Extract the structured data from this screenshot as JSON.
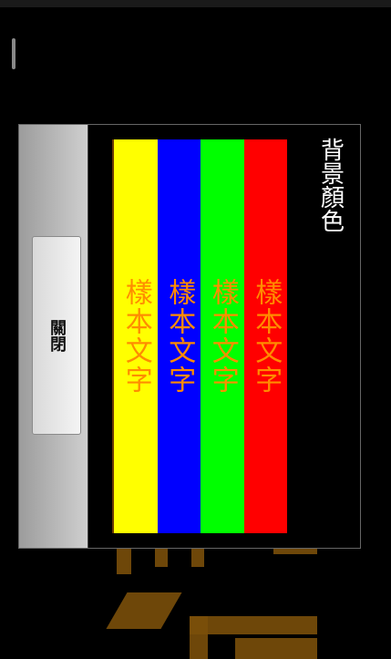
{
  "dialog": {
    "title": "背景顏色",
    "close_label": "關閉"
  },
  "swatches": [
    {
      "label": "樣本文字",
      "background": "#ffff00",
      "text_color": "#ff8c00"
    },
    {
      "label": "樣本文字",
      "background": "#0000ff",
      "text_color": "#ff8c00"
    },
    {
      "label": "樣本文字",
      "background": "#00ff00",
      "text_color": "#ff8c00"
    },
    {
      "label": "樣本文字",
      "background": "#ff0000",
      "text_color": "#ff8c00"
    }
  ],
  "colors": {
    "accent_text": "#ff8c00",
    "background_art": "#7a4f0a"
  }
}
